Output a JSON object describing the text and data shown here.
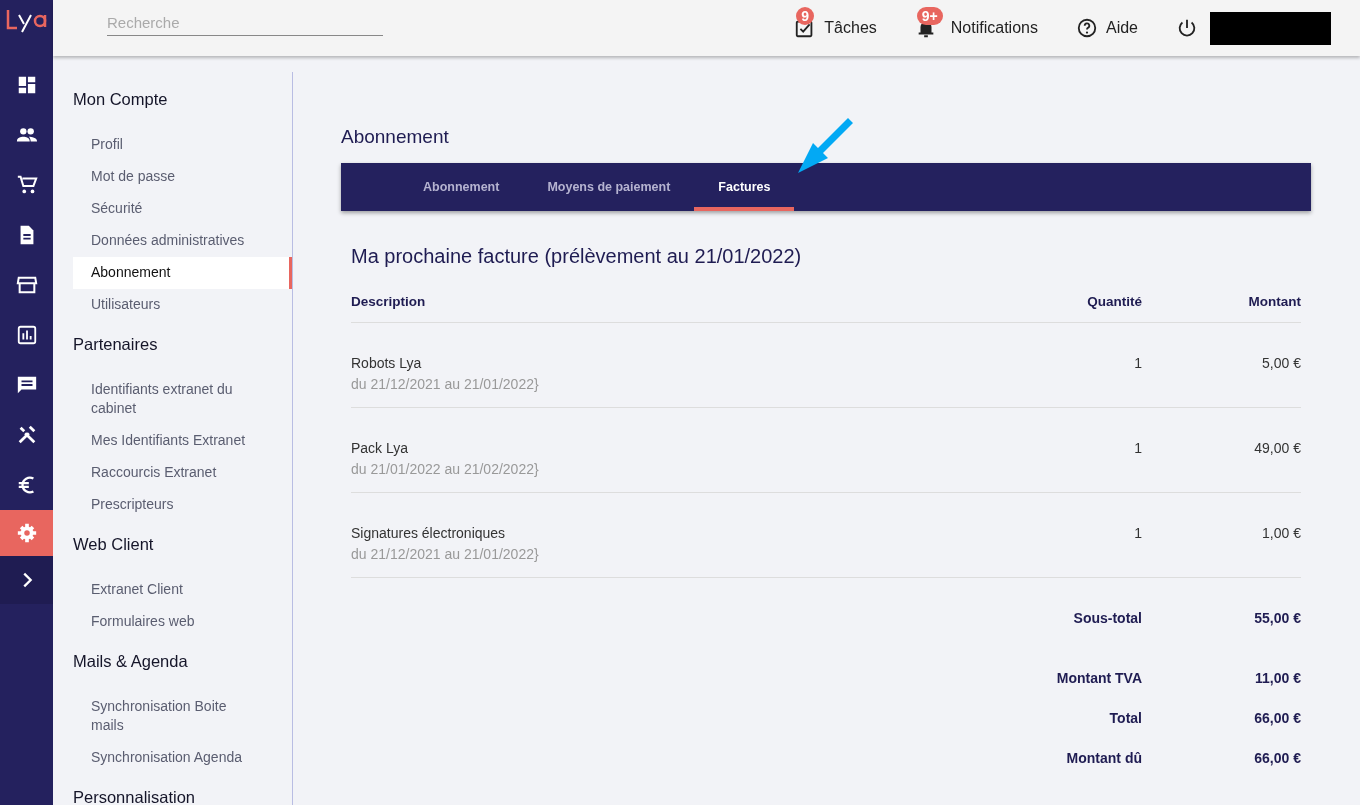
{
  "header": {
    "search": {
      "placeholder": "Recherche"
    },
    "links": [
      {
        "kind": "tasks",
        "label": "Tâches",
        "badge": "9"
      },
      {
        "kind": "bell",
        "label": "Notifications",
        "badge": "9+"
      },
      {
        "kind": "help",
        "label": "Aide"
      },
      {
        "kind": "power"
      }
    ]
  },
  "rail": {
    "items": [
      {
        "kind": "dashboard",
        "selected": false
      },
      {
        "kind": "people",
        "selected": false
      },
      {
        "kind": "cart",
        "selected": false
      },
      {
        "kind": "document",
        "selected": false
      },
      {
        "kind": "store",
        "selected": false
      },
      {
        "kind": "chart",
        "selected": false
      },
      {
        "kind": "chat",
        "selected": false
      },
      {
        "kind": "tools",
        "selected": false
      },
      {
        "kind": "euro",
        "selected": false
      },
      {
        "kind": "settings",
        "selected": true
      },
      {
        "kind": "expand",
        "selected": false
      }
    ]
  },
  "sidebar": {
    "sections": [
      {
        "title": "Mon Compte",
        "items": [
          {
            "label": "Profil",
            "selected": false
          },
          {
            "label": "Mot de passe",
            "selected": false
          },
          {
            "label": "Sécurité",
            "selected": false
          },
          {
            "label": "Données administratives",
            "selected": false
          },
          {
            "label": "Abonnement",
            "selected": true
          },
          {
            "label": "Utilisateurs",
            "selected": false
          }
        ]
      },
      {
        "title": "Partenaires",
        "items": [
          {
            "label": "Identifiants extranet du cabinet",
            "selected": false
          },
          {
            "label": "Mes Identifiants Extranet",
            "selected": false
          },
          {
            "label": "Raccourcis Extranet",
            "selected": false
          },
          {
            "label": "Prescripteurs",
            "selected": false
          }
        ]
      },
      {
        "title": "Web Client",
        "items": [
          {
            "label": "Extranet Client",
            "selected": false
          },
          {
            "label": "Formulaires web",
            "selected": false
          }
        ]
      },
      {
        "title": "Mails & Agenda",
        "items": [
          {
            "label": "Synchronisation Boite mails",
            "selected": false
          },
          {
            "label": "Synchronisation Agenda",
            "selected": false
          }
        ]
      },
      {
        "title": "Personnalisation"
      }
    ]
  },
  "page": {
    "title": "Abonnement",
    "tabs": [
      {
        "label": "Abonnement",
        "selected": false
      },
      {
        "label": "Moyens de paiement",
        "selected": false
      },
      {
        "label": "Factures",
        "selected": true
      }
    ],
    "invoice": {
      "heading": "Ma prochaine facture (prélèvement au 21/01/2022)",
      "columns": [
        "Description",
        "Quantité",
        "Montant"
      ],
      "rows": [
        {
          "description": "Robots Lya",
          "period": "du 21/12/2021 au 21/01/2022}",
          "quantity": "1",
          "amount": "5,00 €"
        },
        {
          "description": "Pack Lya",
          "period": "du 21/01/2022 au 21/02/2022}",
          "quantity": "1",
          "amount": "49,00 €"
        },
        {
          "description": "Signatures électroniques",
          "period": "du 21/12/2021 au 21/01/2022}",
          "quantity": "1",
          "amount": "1,00 €"
        }
      ],
      "totals": [
        {
          "label": "Sous-total",
          "value": "55,00 €"
        },
        {
          "label": "Montant TVA",
          "value": "11,00 €"
        },
        {
          "label": "Total",
          "value": "66,00 €"
        },
        {
          "label": "Montant dû",
          "value": "66,00 €"
        }
      ]
    }
  }
}
